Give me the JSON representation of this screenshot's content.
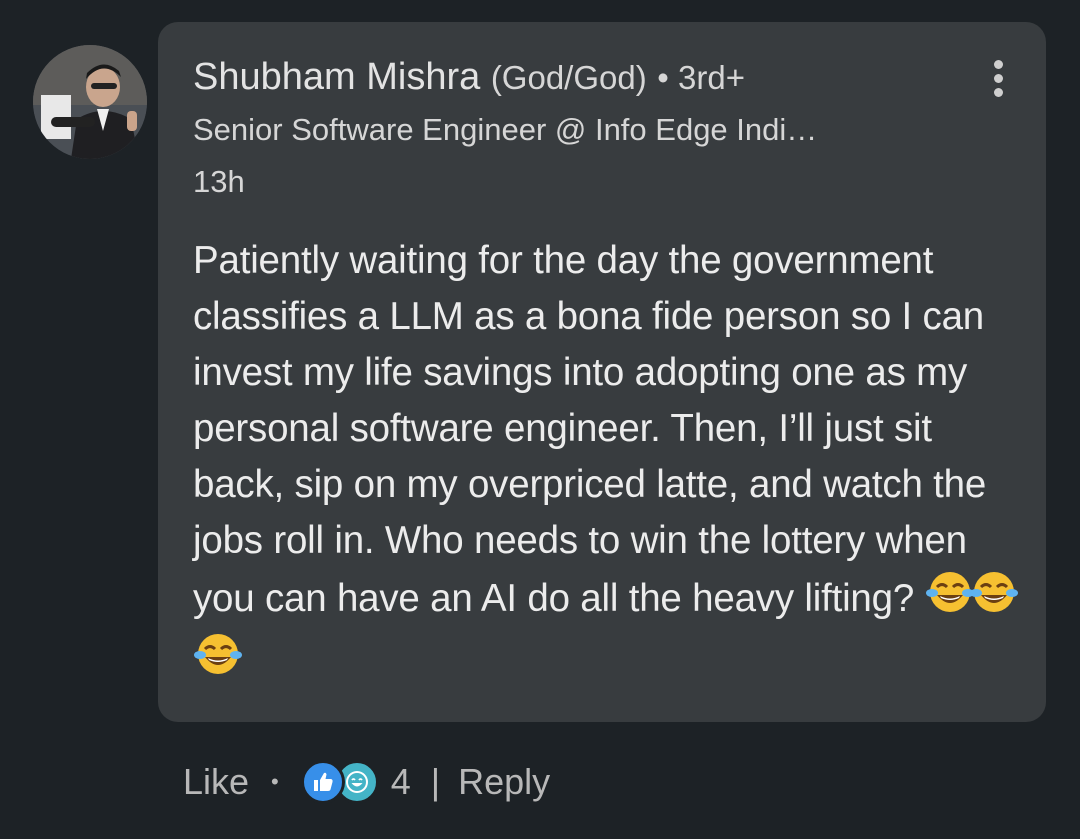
{
  "comment": {
    "author_name": "Shubham Mishra",
    "pronouns": "(God/God)",
    "degree": "• 3rd+",
    "headline": "Senior Software Engineer @ Info Edge Indi…",
    "timestamp": "13h",
    "body": "Patiently waiting for the day the government classifies a LLM as a bona fide person so I can invest my life savings into adopting one as my personal software engineer. Then, I’ll just sit back, sip on my overpriced latte, and watch the jobs roll in. Who needs to win the lottery when you can have an AI do all the heavy lifting?",
    "emojis": [
      "face-with-tears-of-joy-icon",
      "face-with-tears-of-joy-icon",
      "face-with-tears-of-joy-icon"
    ]
  },
  "actions": {
    "like_label": "Like",
    "dot": "•",
    "reaction_count": "4",
    "separator": "|",
    "reply_label": "Reply",
    "reactions": [
      "like-reaction-icon",
      "funny-reaction-icon"
    ]
  },
  "colors": {
    "background": "#1d2226",
    "bubble": "#383c3f",
    "like_reaction": "#378fe9",
    "funny_reaction": "#44b4c7"
  }
}
